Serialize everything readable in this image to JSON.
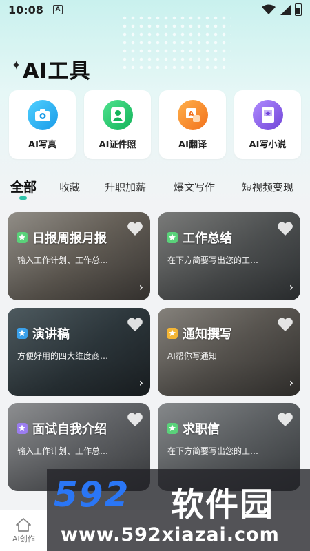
{
  "status_bar": {
    "time": "10:08",
    "notification_badge": "A"
  },
  "header": {
    "title": "AI工具"
  },
  "tools": [
    {
      "label": "AI写真",
      "icon": "camera-icon",
      "color": "#28b4f0"
    },
    {
      "label": "AI证件照",
      "icon": "id-photo-icon",
      "color": "#1fc86b"
    },
    {
      "label": "AI翻译",
      "icon": "translate-icon",
      "color": "#fa8c28"
    },
    {
      "label": "AI写小说",
      "icon": "book-icon",
      "color": "#8c5ae6"
    }
  ],
  "tabs": [
    {
      "label": "全部",
      "active": true
    },
    {
      "label": "收藏"
    },
    {
      "label": "升职加薪"
    },
    {
      "label": "爆文写作"
    },
    {
      "label": "短视频变现"
    }
  ],
  "cards": [
    {
      "title": "日报周报月报",
      "desc": "输入工作计划、工作总…",
      "star_color": "#5ad27a",
      "bg": "#8b8a86"
    },
    {
      "title": "工作总结",
      "desc": "在下方简要写出您的工…",
      "star_color": "#5ad27a",
      "bg": "#6f7377"
    },
    {
      "title": "演讲稿",
      "desc": "方便好用的四大维度商…",
      "star_color": "#3aa0ea",
      "bg": "#4b5a63"
    },
    {
      "title": "通知撰写",
      "desc": "AI帮你写通知",
      "star_color": "#f3b535",
      "bg": "#7a7874"
    },
    {
      "title": "面试自我介绍",
      "desc": "输入工作计划、工作总…",
      "star_color": "#9b7df0",
      "bg": "#8d8f93"
    },
    {
      "title": "求职信",
      "desc": "在下方简要写出您的工…",
      "star_color": "#5ad27a",
      "bg": "#7d8286"
    }
  ],
  "bottom_nav": {
    "items": [
      {
        "label": "AI创作",
        "icon": "home-icon"
      }
    ]
  },
  "watermark": {
    "logo": "592",
    "name": "软件园",
    "url": "www.592xiazai.com"
  },
  "colors": {
    "accent": "#2ec1a8",
    "header_bg": "#c9f1ee"
  }
}
